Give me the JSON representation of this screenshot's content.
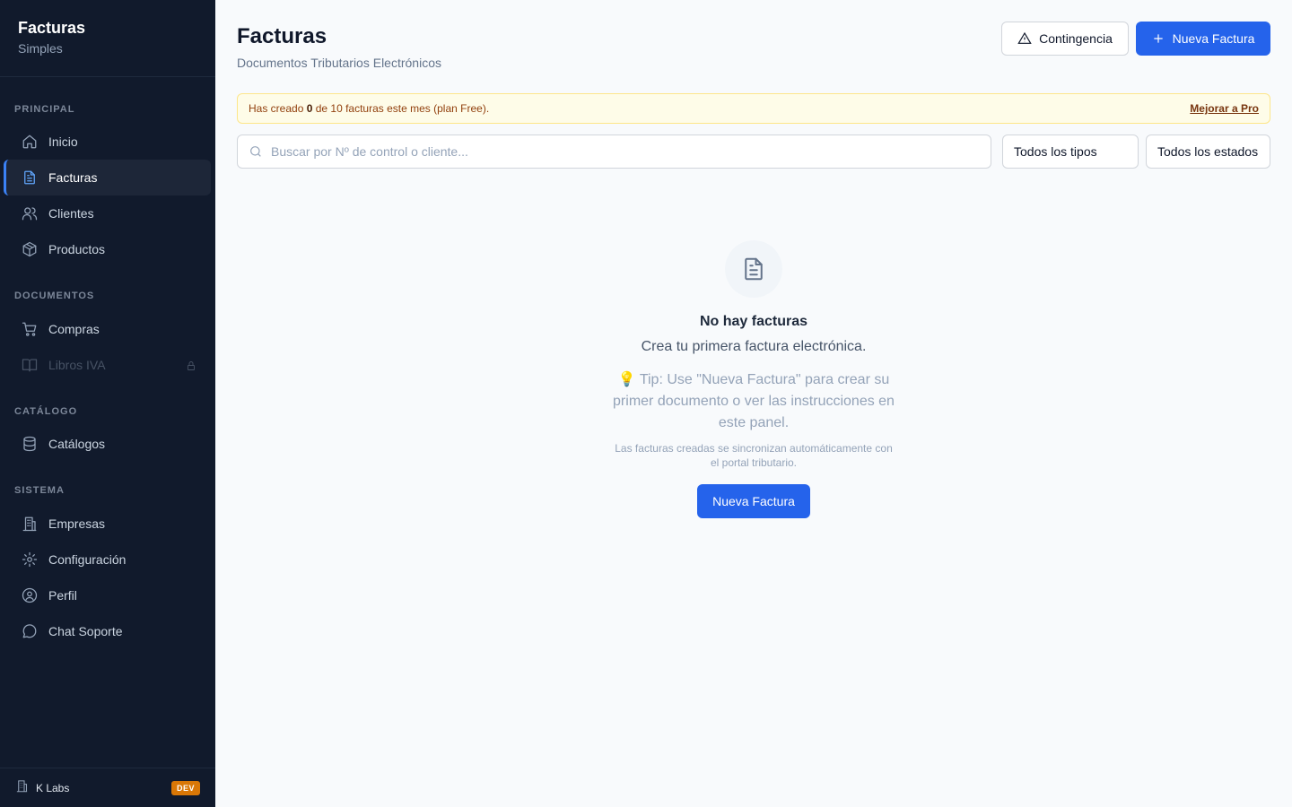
{
  "sidebar": {
    "brand_title": "Facturas",
    "brand_subtitle": "Simples",
    "sections": {
      "principal": "PRINCIPAL",
      "documentos": "DOCUMENTOS",
      "catalogo": "CATÁLOGO",
      "sistema": "SISTEMA"
    },
    "items": [
      {
        "label": "Inicio",
        "icon": "home-icon",
        "active": false
      },
      {
        "label": "Facturas",
        "icon": "document-icon",
        "active": true
      },
      {
        "label": "Clientes",
        "icon": "users-icon",
        "active": false
      },
      {
        "label": "Productos",
        "icon": "package-icon",
        "active": false
      },
      {
        "label": "Compras",
        "icon": "cart-icon",
        "active": false
      },
      {
        "label": "Libros IVA",
        "icon": "book-icon",
        "active": false,
        "locked": true
      },
      {
        "label": "Catálogos",
        "icon": "database-icon",
        "active": false
      },
      {
        "label": "Empresas",
        "icon": "building-icon",
        "active": false
      },
      {
        "label": "Configuración",
        "icon": "gear-icon",
        "active": false
      },
      {
        "label": "Perfil",
        "icon": "user-circle-icon",
        "active": false
      },
      {
        "label": "Chat Soporte",
        "icon": "chat-icon",
        "active": false
      }
    ],
    "footer": {
      "org_name": "K Labs",
      "env_badge": "DEV"
    }
  },
  "header": {
    "title": "Facturas",
    "subtitle": "Documentos Tributarios Electrónicos",
    "contingency_label": "Contingencia",
    "new_invoice_label": "Nueva Factura"
  },
  "banner": {
    "prefix": "Has creado ",
    "count": "0",
    "suffix": " de 10 facturas este mes (plan Free).",
    "link": "Mejorar a Pro"
  },
  "filters": {
    "search_placeholder": "Buscar por Nº de control o cliente...",
    "type_select": "Todos los tipos",
    "status_select": "Todos los estados"
  },
  "empty_state": {
    "title": "No hay facturas",
    "description": "Crea tu primera factura electrónica.",
    "tip": "💡 Tip: Use \"Nueva Factura\" para crear su primer documento o ver las instrucciones en este panel.",
    "note": "Las facturas creadas se sincronizan automáticamente con el portal tributario.",
    "button_label": "Nueva Factura"
  },
  "colors": {
    "sidebar_bg": "#111a2c",
    "accent": "#2563eb",
    "banner_bg": "#fefce8",
    "badge": "#d97706"
  }
}
